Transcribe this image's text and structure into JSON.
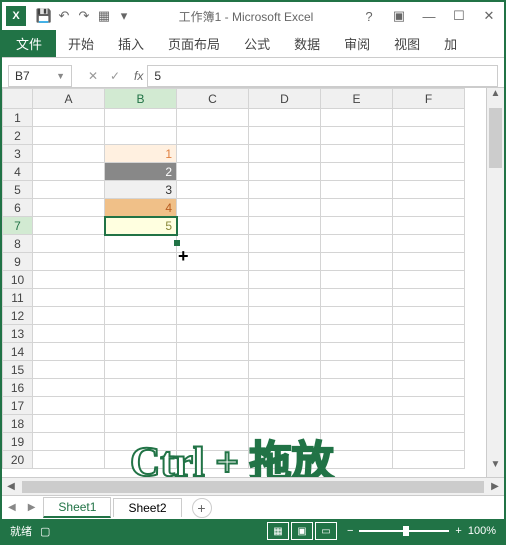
{
  "title": "工作簿1 - Microsoft Excel",
  "app_abbr": "X",
  "tabs": {
    "file": "文件",
    "items": [
      "开始",
      "插入",
      "页面布局",
      "公式",
      "数据",
      "审阅",
      "视图",
      "加"
    ]
  },
  "name_box": "B7",
  "formula_value": "5",
  "columns": [
    "A",
    "B",
    "C",
    "D",
    "E",
    "F"
  ],
  "rows": [
    "1",
    "2",
    "3",
    "4",
    "5",
    "6",
    "7",
    "8",
    "9",
    "10",
    "11",
    "12",
    "13",
    "14",
    "15",
    "16",
    "17",
    "18",
    "19",
    "20"
  ],
  "selected_col": "B",
  "selected_row": "7",
  "cells": {
    "b3": "1",
    "b4": "2",
    "b5": "3",
    "b6": "4",
    "b7": "5"
  },
  "overlay": "Ctrl + 拖放",
  "sheets": {
    "active": "Sheet1",
    "other": "Sheet2",
    "add": "+"
  },
  "status": {
    "ready": "就绪",
    "zoom": "100%"
  },
  "chart_data": {
    "type": "table",
    "title": "Excel cells B3:B7",
    "columns": [
      "B"
    ],
    "rows": [
      {
        "row": 3,
        "B": 1
      },
      {
        "row": 4,
        "B": 2
      },
      {
        "row": 5,
        "B": 3
      },
      {
        "row": 6,
        "B": 4
      },
      {
        "row": 7,
        "B": 5
      }
    ]
  }
}
